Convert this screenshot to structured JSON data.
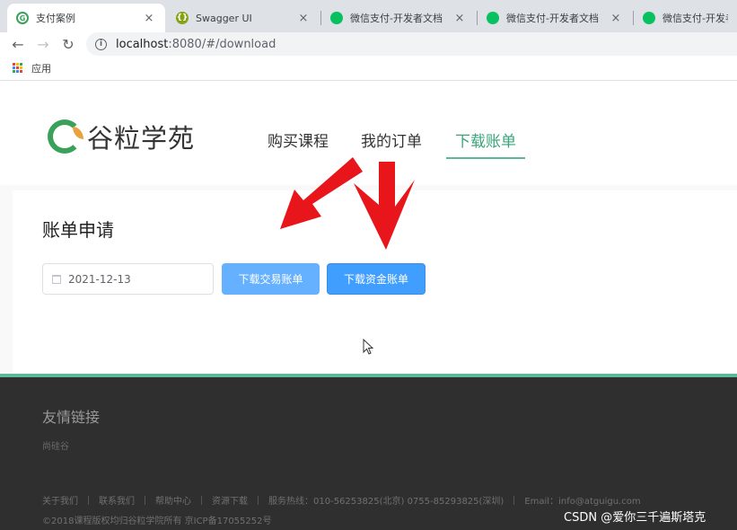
{
  "browser": {
    "tabs": [
      {
        "title": "支付案例",
        "icon": "chrome-g-icon",
        "color": "#3aa15b",
        "active": true
      },
      {
        "title": "Swagger UI",
        "icon": "swagger-icon",
        "color": "#85a317",
        "active": false
      },
      {
        "title": "微信支付-开发者文档",
        "icon": "wechat-icon",
        "color": "#07c160",
        "active": false
      },
      {
        "title": "微信支付-开发者文档",
        "icon": "wechat-icon",
        "color": "#07c160",
        "active": false
      },
      {
        "title": "微信支付-开发者文档",
        "icon": "wechat-icon",
        "color": "#07c160",
        "active": false
      }
    ],
    "close_glyph": "×",
    "url_host": "localhost",
    "url_rest": ":8080/#/download",
    "bookmarks_label": "应用"
  },
  "site": {
    "logo_text": "谷粒学苑",
    "nav": {
      "buy": "购买课程",
      "orders": "我的订单",
      "download": "下载账单"
    },
    "accent": "#3aa57a"
  },
  "bill": {
    "heading": "账单申请",
    "date": "2021-12-13",
    "trade_button": "下载交易账单",
    "fund_button": "下载资金账单"
  },
  "footer": {
    "friend_title": "友情链接",
    "friend_link": "尚硅谷",
    "links": [
      "关于我们",
      "联系我们",
      "帮助中心",
      "资源下载",
      "服务热线：010-56253825(北京) 0755-85293825(深圳)",
      "Email：info@atguigu.com"
    ],
    "copyright": "©2018课程版权均归谷粒学院所有 京ICP备17055252号"
  },
  "watermark": "CSDN @爱你三千遍斯塔克"
}
